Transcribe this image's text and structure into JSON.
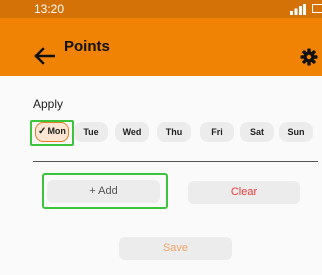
{
  "status_bar": {
    "time": "13:20",
    "icons": [
      "signal-icon",
      "battery-icon"
    ]
  },
  "app_bar": {
    "title": "Points",
    "icons": [
      "back-arrow-icon",
      "gear-icon"
    ]
  },
  "apply": {
    "label": "Apply",
    "days": [
      "Mon",
      "Tue",
      "Wed",
      "Thu",
      "Fri",
      "Sat",
      "Sun"
    ],
    "selected": "Mon"
  },
  "actions": {
    "add_label": "+ Add",
    "clear_label": "Clear",
    "save_label": "Save"
  },
  "colors": {
    "status_bar": "#d47207",
    "app_bar": "#f08204",
    "selected_border": "#e77d22",
    "highlight_outline": "#3cc43c",
    "clear_text": "#e63b3b",
    "save_text": "#f3a36b"
  }
}
